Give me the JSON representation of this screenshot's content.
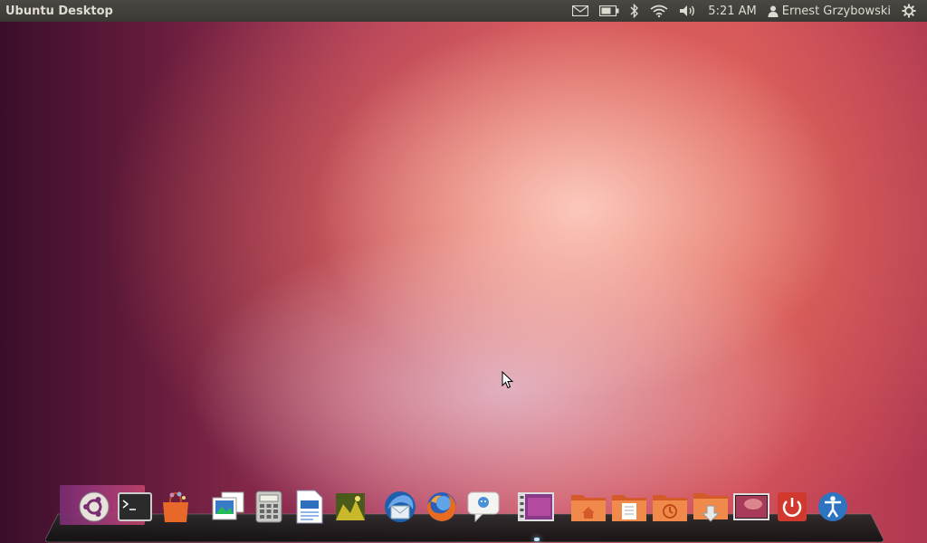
{
  "panel": {
    "title": "Ubuntu Desktop",
    "indicators": [
      {
        "icon": "mail-icon"
      },
      {
        "icon": "battery-icon"
      },
      {
        "icon": "bluetooth-icon"
      },
      {
        "icon": "wifi-icon"
      },
      {
        "icon": "volume-icon"
      }
    ],
    "clock": "5:21 AM",
    "user": "Ernest Grzybowski",
    "session_icon": "gear-icon"
  },
  "dock": {
    "items": [
      {
        "name": "ubuntu-icon"
      },
      {
        "name": "terminal-icon"
      },
      {
        "name": "software-center-icon"
      },
      {
        "name": "image-viewer-icon"
      },
      {
        "name": "calculator-icon"
      },
      {
        "name": "text-document-icon"
      },
      {
        "name": "photo-manager-icon"
      },
      {
        "name": "thunderbird-icon"
      },
      {
        "name": "firefox-icon"
      },
      {
        "name": "chat-icon"
      },
      {
        "name": "video-icon"
      },
      {
        "name": "home-folder-icon"
      },
      {
        "name": "documents-folder-icon"
      },
      {
        "name": "recent-folder-icon"
      },
      {
        "name": "downloads-folder-icon"
      },
      {
        "name": "show-desktop-icon"
      },
      {
        "name": "power-icon"
      },
      {
        "name": "accessibility-icon"
      }
    ]
  },
  "colors": {
    "panel": "#3c3b37",
    "panel_text": "#dfdbd2",
    "accent_orange": "#e9582c"
  }
}
